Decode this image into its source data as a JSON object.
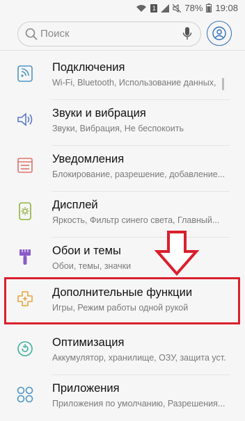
{
  "status": {
    "battery": "78%",
    "time": "19:08",
    "sim": "1"
  },
  "search": {
    "placeholder": "Поиск"
  },
  "items": [
    {
      "title": "Подключения",
      "subtitle": "Wi-Fi, Bluetooth, Использование данных,"
    },
    {
      "title": "Звуки и вибрация",
      "subtitle": "Звуки, Вибрация, Не беспокоить"
    },
    {
      "title": "Уведомления",
      "subtitle": "Блокирование, разрешение, добавление..."
    },
    {
      "title": "Дисплей",
      "subtitle": "Яркость, Фильтр синего света, Главный..."
    },
    {
      "title": "Обои и темы",
      "subtitle": "Обои, темы, значки"
    },
    {
      "title": "Дополнительные функции",
      "subtitle": "Игры, Режим работы одной рукой"
    },
    {
      "title": "Оптимизация",
      "subtitle": "Аккумулятор, хранилище, ОЗУ, защита уст..."
    },
    {
      "title": "Приложения",
      "subtitle": "Приложения по умолчанию, Разрешения..."
    }
  ],
  "colors": {
    "accent": "#2f6fb5",
    "highlight": "#d9202e",
    "icon": "#4f95c7"
  }
}
